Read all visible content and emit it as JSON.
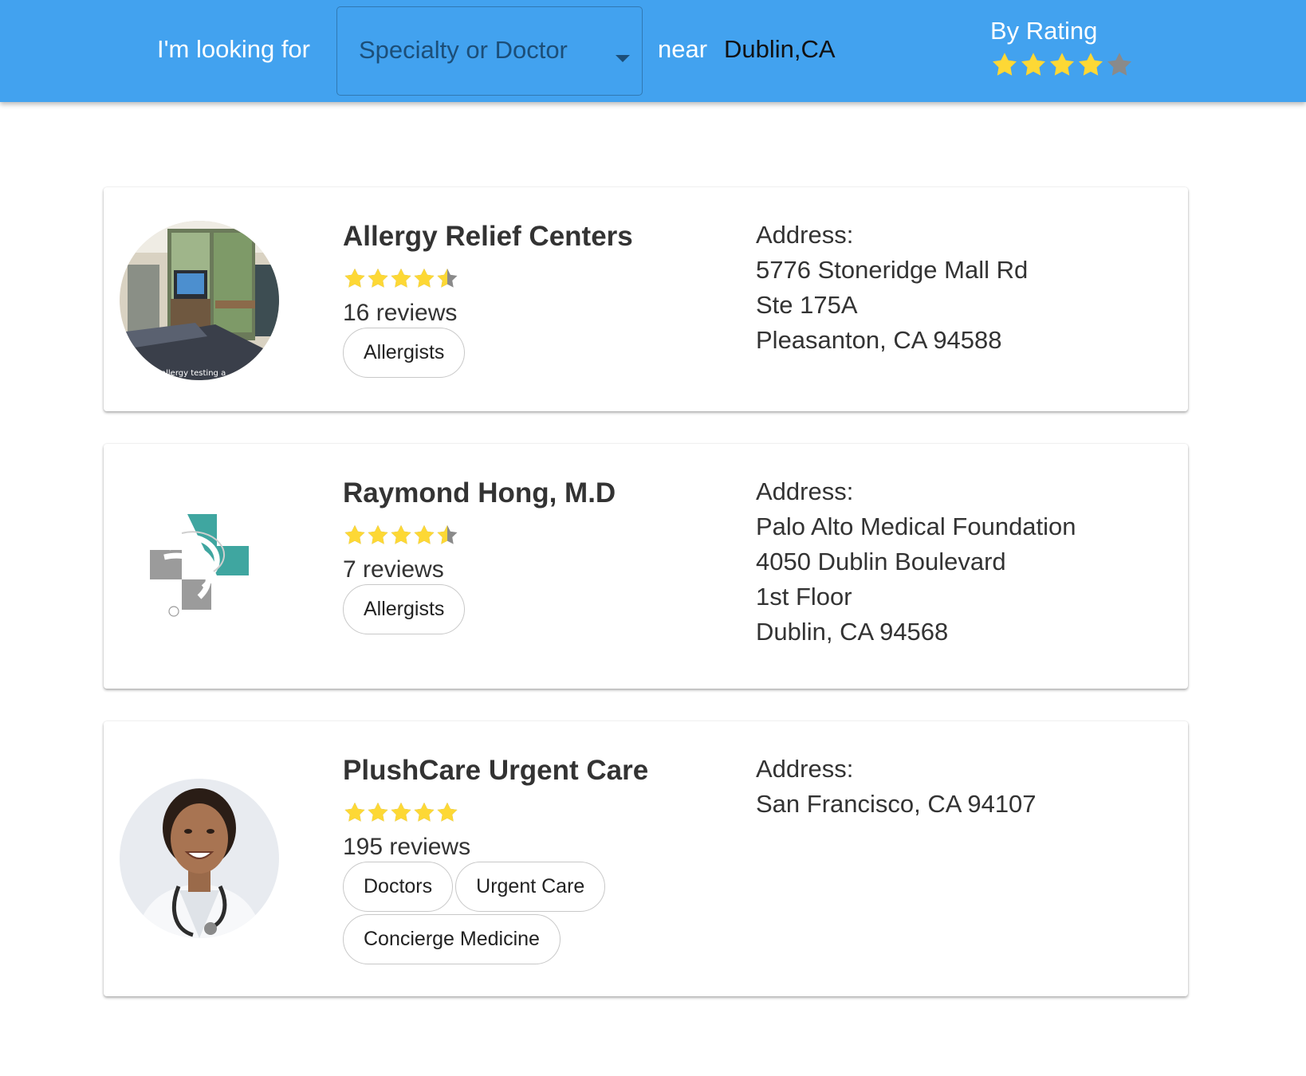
{
  "header": {
    "looking_label": "I'm looking for",
    "select_value": "Specialty or Doctor",
    "near_label": "near",
    "location": "Dublin,CA",
    "rating_label": "By Rating",
    "rating_filter_stars": 4
  },
  "colors": {
    "header_bg": "#42a2ef",
    "star_filled": "#fdd835",
    "star_empty": "#8a8a8a"
  },
  "results": [
    {
      "name": "Allergy Relief Centers",
      "rating": 4.5,
      "reviews": "16 reviews",
      "tags": [
        "Allergists"
      ],
      "address_label": "Address:",
      "address_lines": [
        "5776 Stoneridge Mall Rd",
        "Ste 175A",
        "Pleasanton, CA 94588"
      ],
      "image": "clinic-room-photo",
      "image_caption": "allergy testing a"
    },
    {
      "name": "Raymond Hong, M.D",
      "rating": 4.5,
      "reviews": "7 reviews",
      "tags": [
        "Allergists"
      ],
      "address_label": "Address:",
      "address_lines": [
        "Palo Alto Medical Foundation",
        "4050 Dublin Boulevard",
        "1st Floor",
        "Dublin, CA 94568"
      ],
      "image": "sutter-health-logo"
    },
    {
      "name": "PlushCare Urgent Care",
      "rating": 5,
      "reviews": "195 reviews",
      "tags": [
        "Doctors",
        "Urgent Care",
        "Concierge Medicine"
      ],
      "address_label": "Address:",
      "address_lines": [
        "San Francisco, CA 94107"
      ],
      "image": "doctor-portrait-photo"
    }
  ]
}
